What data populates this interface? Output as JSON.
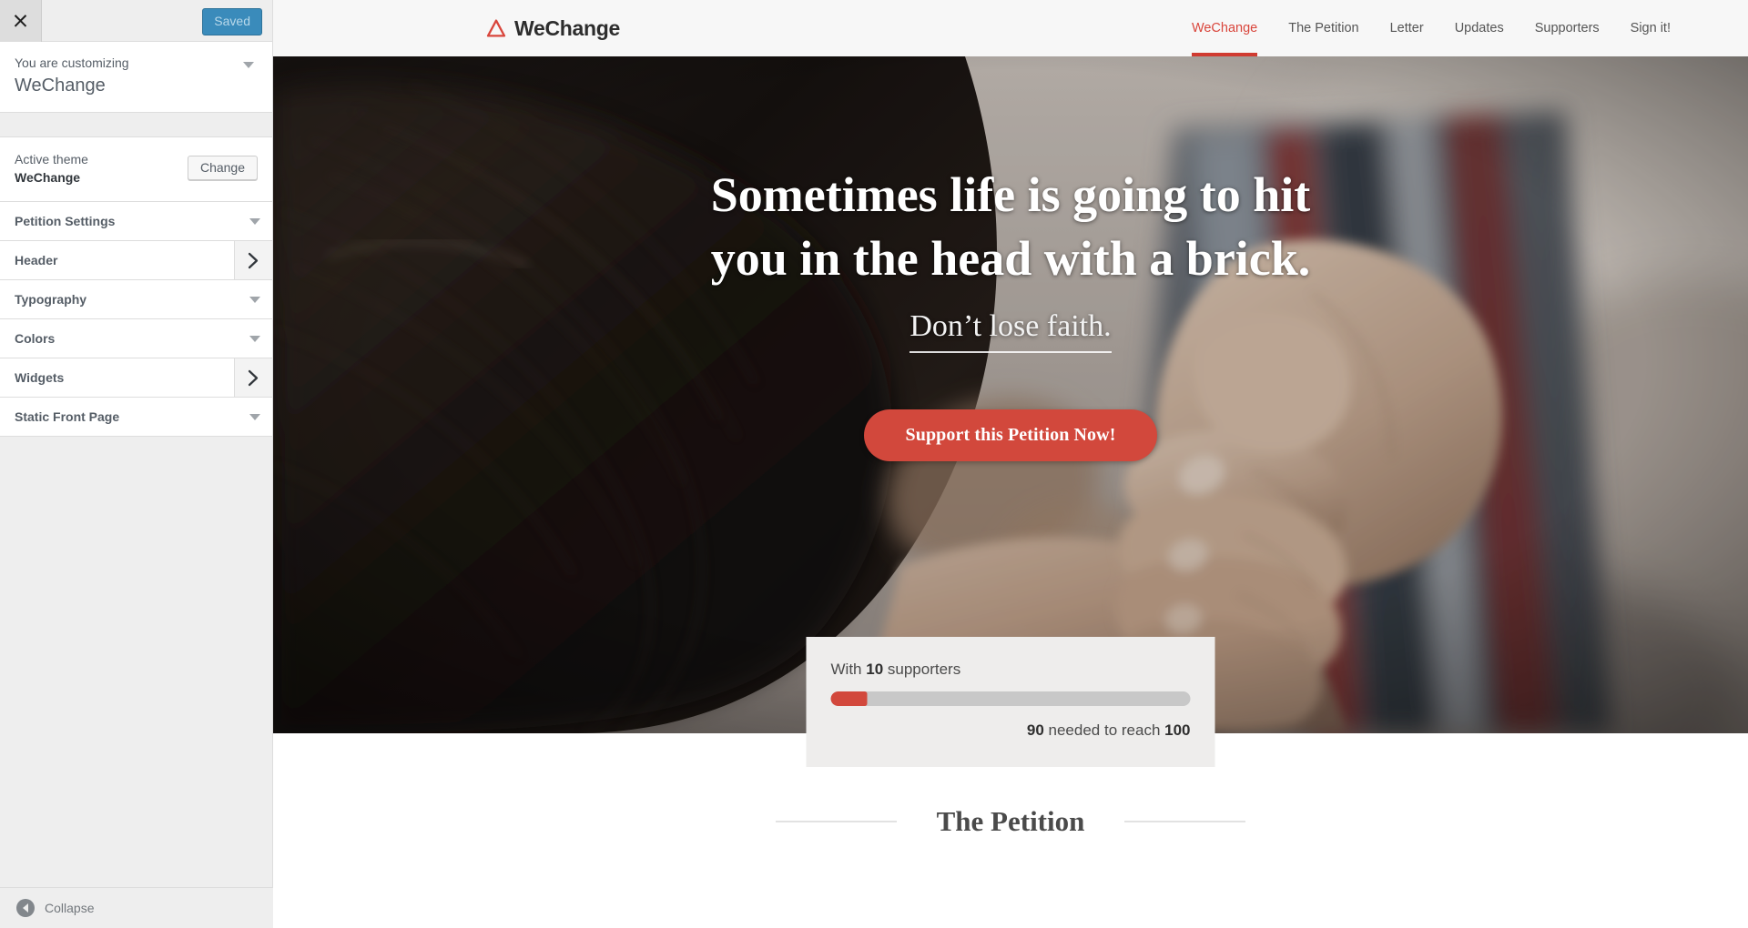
{
  "customizer": {
    "close_icon": "close-icon",
    "save_button": "Saved",
    "customizing_label": "You are customizing",
    "site_title": "WeChange",
    "active_theme_label": "Active theme",
    "active_theme_name": "WeChange",
    "change_button": "Change",
    "sections": [
      {
        "label": "Petition Settings",
        "control": "caret"
      },
      {
        "label": "Header",
        "control": "arrow"
      },
      {
        "label": "Typography",
        "control": "caret"
      },
      {
        "label": "Colors",
        "control": "caret"
      },
      {
        "label": "Widgets",
        "control": "arrow"
      },
      {
        "label": "Static Front Page",
        "control": "caret"
      }
    ],
    "collapse_label": "Collapse"
  },
  "site": {
    "brand": {
      "logo_icon": "triangle-logo-icon",
      "name": "WeChange"
    },
    "nav": [
      {
        "label": "WeChange",
        "active": true
      },
      {
        "label": "The Petition",
        "active": false
      },
      {
        "label": "Letter",
        "active": false
      },
      {
        "label": "Updates",
        "active": false
      },
      {
        "label": "Supporters",
        "active": false
      },
      {
        "label": "Sign it!",
        "active": false
      }
    ],
    "hero": {
      "title_line1": "Sometimes life is going to hit",
      "title_line2": "you in the head with a brick.",
      "subtitle": "Don’t lose faith.",
      "cta_label": "Support this Petition Now!"
    },
    "supporters": {
      "prefix": "With ",
      "count": "10",
      "suffix": " supporters",
      "needed": "90",
      "needed_mid": " needed to reach ",
      "goal": "100",
      "progress_percent": 10
    },
    "petition_section": {
      "title": "The Petition"
    }
  },
  "colors": {
    "accent_red": "#d2483c",
    "nav_active": "#d9463c",
    "customizer_bg": "#eeeeee",
    "save_blue": "#3a8bbb"
  }
}
